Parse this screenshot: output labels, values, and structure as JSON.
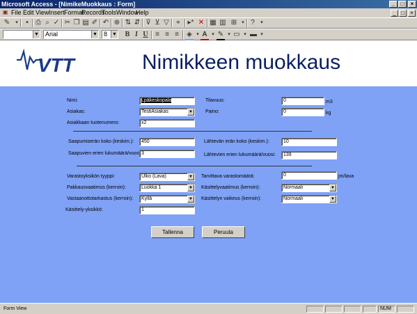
{
  "window": {
    "title": "Microsoft Access - [NimikeMuokkaus : Form]",
    "buttons": [
      "_",
      "□",
      "×"
    ]
  },
  "menu": [
    "File",
    "Edit",
    "View",
    "Insert",
    "Format",
    "Records",
    "Tools",
    "Window",
    "Help"
  ],
  "toolbar": {
    "font_name": "Arial",
    "font_size": "8",
    "bold": "B",
    "italic": "I",
    "underline": "U"
  },
  "form": {
    "logo_text": "VTT",
    "title": "Nimikkeen muokkaus",
    "fields": {
      "nimi": {
        "label": "Nimi:",
        "value": "Lpäkeskopala"
      },
      "tilavuus": {
        "label": "Tilavuus:",
        "value": "0",
        "unit": "m3"
      },
      "asiakas": {
        "label": "Asiakas:",
        "value": "TestiAsiakas"
      },
      "paino": {
        "label": "Paino:",
        "value": "0",
        "unit": "kg"
      },
      "asiakkaan_tuotenumero": {
        "label": "Asiakkaan tuotenumero:",
        "value": "x2"
      },
      "saapumiseran_koko": {
        "label": "Saapumiserän koko (keskim.):",
        "value": "450"
      },
      "lahtevan_eran_koko": {
        "label": "Lähtevän erän koko (keskim.):",
        "value": "10"
      },
      "saapuvien_erien_lkm": {
        "label": "Saapuvien erien lukumäärä/vuosi:",
        "value": "3"
      },
      "lahtevien_erien_lkm": {
        "label": "Lähtevien erien lukumäärä/vuosi:",
        "value": "139"
      },
      "varastoyksikon_tyyppi": {
        "label": "Varastoyksikön tyyppi:",
        "value": "Ulko (Lava)"
      },
      "tarvittava_varastomaara": {
        "label": "Tarvittava varastomäärä:",
        "value": "0",
        "unit": "jm/lava"
      },
      "pakkausvaatimus": {
        "label": "Pakkausvaatimus (kerroin):",
        "value": "Luokka 1"
      },
      "kasittelyvaatimus": {
        "label": "Käsittelyvaatimus (kerroin):",
        "value": "Normaali"
      },
      "vastaanottotarkastus": {
        "label": "Vastaanottotarkastus (kerroin):",
        "value": "Kyllä"
      },
      "kasittelyn_vaikeus": {
        "label": "Käsittelyn vaikeus (kerroin):",
        "value": "Normaali"
      },
      "kasittely_yksikko": {
        "label": "Käsittely-yksikkö:",
        "value": "1"
      }
    },
    "save_button": "Tallenna",
    "cancel_button": "Peruuta"
  },
  "status": {
    "left": "Form View",
    "num": "NUM"
  },
  "colors": {
    "form_body": "#7fa2f6",
    "title_text": "#0b1e63",
    "logo": "#1a3a8a",
    "titlebar_start": "#0a246a",
    "titlebar_end": "#3a6ea5"
  }
}
